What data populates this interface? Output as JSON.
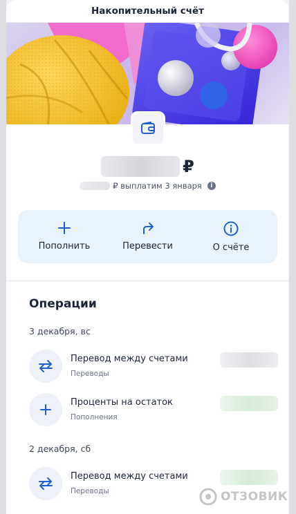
{
  "header": {
    "title": "Накопительный счёт"
  },
  "balance": {
    "currency_symbol": "₽",
    "payout_text": "₽ выплатим 3 января"
  },
  "actions": [
    {
      "label": "Пополнить",
      "icon": "plus-icon"
    },
    {
      "label": "Перевести",
      "icon": "forward-arrow-icon"
    },
    {
      "label": "О счёте",
      "icon": "info-icon"
    }
  ],
  "operations": {
    "title": "Операции",
    "groups": [
      {
        "date": "3 декабря, вс",
        "items": [
          {
            "name": "Перевод между счетами",
            "category": "Переводы",
            "icon": "transfer-arrows-icon"
          },
          {
            "name": "Проценты на остаток",
            "category": "Пополнения",
            "icon": "plus-icon"
          }
        ]
      },
      {
        "date": "2 декабря, сб",
        "items": [
          {
            "name": "Перевод между счетами",
            "category": "Переводы",
            "icon": "transfer-arrows-icon"
          }
        ]
      }
    ]
  },
  "watermark": "ОТЗОВИК",
  "colors": {
    "accent": "#1f5fcf",
    "action_bg": "#e9f3fc",
    "text": "#1c2537",
    "banner_yellow": "#f2c233"
  }
}
